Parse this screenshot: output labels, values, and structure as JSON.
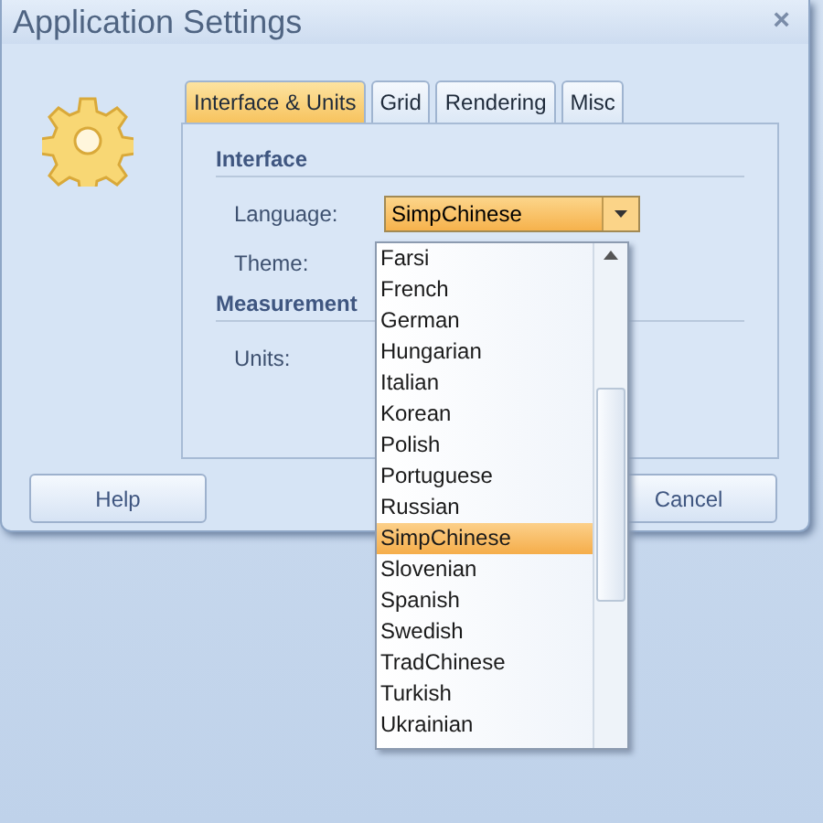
{
  "window": {
    "title": "Application Settings",
    "close": "×"
  },
  "tabs": [
    {
      "label": "Interface & Units",
      "selected": true
    },
    {
      "label": "Grid",
      "selected": false
    },
    {
      "label": "Rendering",
      "selected": false
    },
    {
      "label": "Misc",
      "selected": false
    }
  ],
  "sections": [
    {
      "title": "Interface",
      "fields": [
        {
          "label": "Language:",
          "kind": "combo",
          "value": "SimpChinese",
          "expanded": true
        },
        {
          "label": "Theme:",
          "kind": "plain"
        }
      ]
    },
    {
      "title": "Measurement",
      "fields": [
        {
          "label": "Units:",
          "kind": "plain"
        }
      ]
    }
  ],
  "dropdown": {
    "items": [
      {
        "label": "Farsi",
        "selected": false
      },
      {
        "label": "French",
        "selected": false
      },
      {
        "label": "German",
        "selected": false
      },
      {
        "label": "Hungarian",
        "selected": false
      },
      {
        "label": "Italian",
        "selected": false
      },
      {
        "label": "Korean",
        "selected": false
      },
      {
        "label": "Polish",
        "selected": false
      },
      {
        "label": "Portuguese",
        "selected": false
      },
      {
        "label": "Russian",
        "selected": false
      },
      {
        "label": "SimpChinese",
        "selected": true
      },
      {
        "label": "Slovenian",
        "selected": false
      },
      {
        "label": "Spanish",
        "selected": false
      },
      {
        "label": "Swedish",
        "selected": false
      },
      {
        "label": "TradChinese",
        "selected": false
      },
      {
        "label": "Turkish",
        "selected": false
      },
      {
        "label": "Ukrainian",
        "selected": false
      }
    ]
  },
  "buttons": [
    {
      "label": "Help"
    },
    {
      "label": "Cancel"
    }
  ]
}
